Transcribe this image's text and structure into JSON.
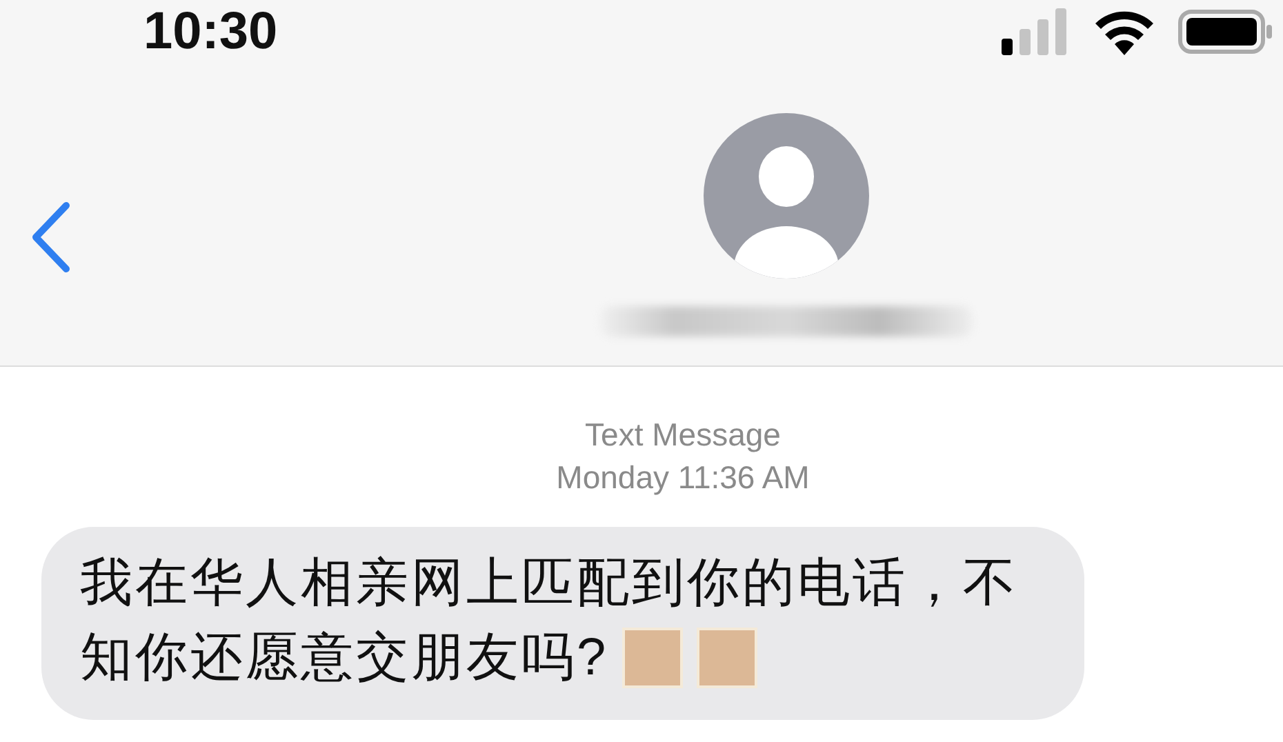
{
  "status_bar": {
    "time": "10:30"
  },
  "conversation": {
    "label": "Text Message",
    "timestamp": "Monday 11:36 AM"
  },
  "messages": [
    {
      "kind": "incoming",
      "lines": [
        "我在华人相亲网上匹配到你的电话，不",
        "知你还愿意交朋友吗?"
      ],
      "emoji": [
        {
          "kind": "placeholder"
        },
        {
          "kind": "placeholder"
        }
      ]
    }
  ]
}
